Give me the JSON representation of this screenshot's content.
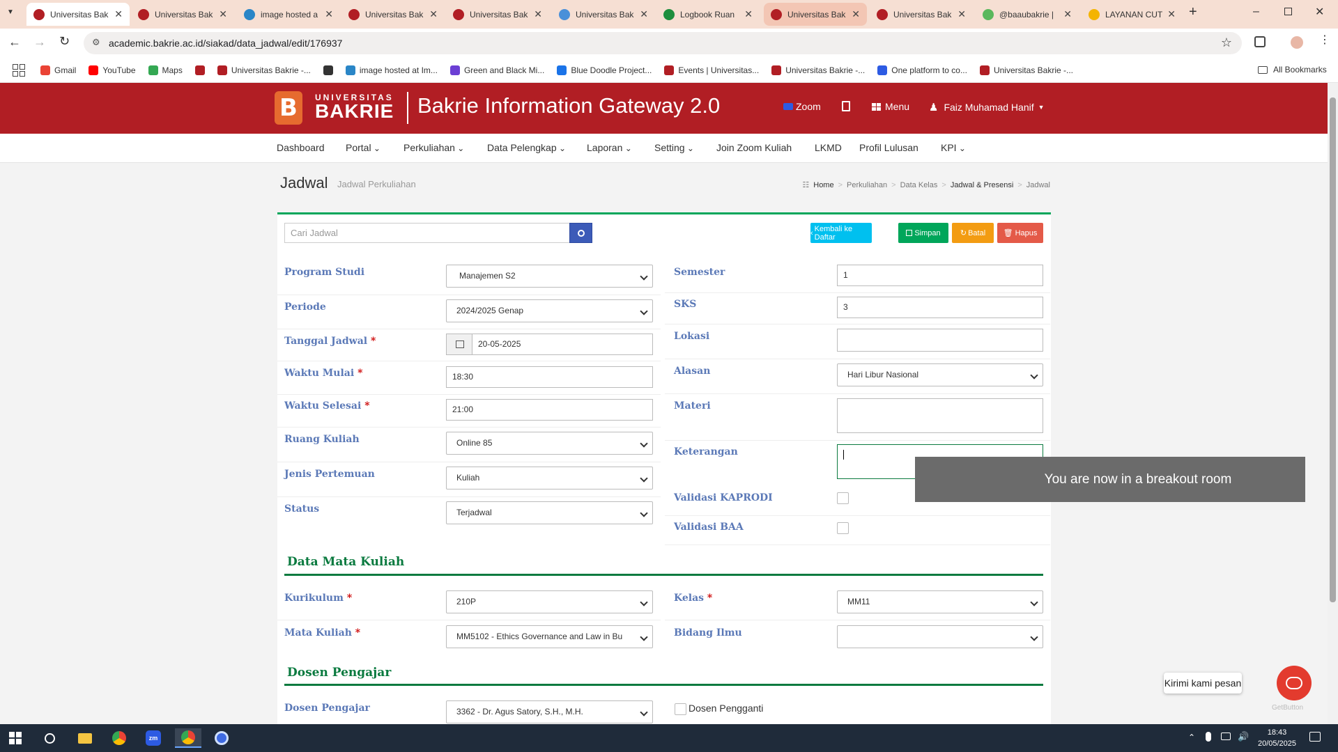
{
  "browser": {
    "tabs": [
      {
        "title": "Universitas Bak",
        "active": true,
        "color": "#b11e24"
      },
      {
        "title": "Universitas Bak",
        "color": "#b11e24"
      },
      {
        "title": "image hosted a",
        "color": "#2a86c7"
      },
      {
        "title": "Universitas Bak",
        "color": "#b11e24"
      },
      {
        "title": "Universitas Bak",
        "color": "#b11e24"
      },
      {
        "title": "Universitas Bak",
        "color": "#4a90d9"
      },
      {
        "title": "Logbook Ruan",
        "color": "#1e8e3e"
      },
      {
        "title": "Universitas Bak",
        "highlighted": true,
        "color": "#b11e24"
      },
      {
        "title": "Universitas Bak",
        "color": "#b11e24"
      },
      {
        "title": "@baaubakrie |",
        "color": "#5bb85d"
      },
      {
        "title": "LAYANAN CUT",
        "color": "#f4b400"
      }
    ],
    "url": "academic.bakrie.ac.id/siakad/data_jadwal/edit/176937",
    "bookmarks": [
      {
        "label": "Gmail",
        "color": "#ea4335"
      },
      {
        "label": "YouTube",
        "color": "#ff0000"
      },
      {
        "label": "Maps",
        "color": "#34a853"
      },
      {
        "label": "",
        "color": "#b11e24"
      },
      {
        "label": "Universitas Bakrie -...",
        "color": "#b11e24"
      },
      {
        "label": "",
        "color": "#333333"
      },
      {
        "label": "image hosted at Im...",
        "color": "#2a86c7"
      },
      {
        "label": "Green and Black Mi...",
        "color": "#6b3fd4"
      },
      {
        "label": "Blue Doodle Project...",
        "color": "#1a73e8"
      },
      {
        "label": "Events | Universitas...",
        "color": "#b11e24"
      },
      {
        "label": "Universitas Bakrie -...",
        "color": "#b11e24"
      },
      {
        "label": "One platform to co...",
        "color": "#2d5be3"
      },
      {
        "label": "Universitas Bakrie -...",
        "color": "#b11e24"
      }
    ],
    "all_bookmarks": "All Bookmarks"
  },
  "header": {
    "logo_line1": "UNIVERSITAS",
    "logo_line2": "BAKRIE",
    "title": "Bakrie Information Gateway 2.0",
    "zoom": "Zoom",
    "menu": "Menu",
    "user": "Faiz Muhamad Hanif",
    "brand_color": "#b11e24"
  },
  "nav": [
    "Dashboard",
    "Portal",
    "Perkuliahan",
    "Data Pelengkap",
    "Laporan",
    "Setting",
    "Join Zoom Kuliah",
    "LKMD",
    "Profil Lulusan",
    "KPI"
  ],
  "page": {
    "title": "Jadwal",
    "subtitle": "Jadwal Perkuliahan",
    "breadcrumb": [
      "Home",
      "Perkuliahan",
      "Data Kelas",
      "Jadwal & Presensi",
      "Jadwal"
    ]
  },
  "toolbar": {
    "search_placeholder": "Cari Jadwal",
    "back": "Kembali ke Daftar",
    "save": "Simpan",
    "cancel": "Batal",
    "delete": "Hapus"
  },
  "form_left": {
    "program_studi": {
      "label": "Program Studi",
      "value": "Manajemen S2"
    },
    "periode": {
      "label": "Periode",
      "value": "2024/2025 Genap"
    },
    "tanggal": {
      "label": "Tanggal Jadwal",
      "value": "20-05-2025"
    },
    "waktu_mulai": {
      "label": "Waktu Mulai",
      "value": "18:30"
    },
    "waktu_selesai": {
      "label": "Waktu Selesai",
      "value": "21:00"
    },
    "ruang": {
      "label": "Ruang Kuliah",
      "value": "Online 85"
    },
    "jenis": {
      "label": "Jenis Pertemuan",
      "value": "Kuliah"
    },
    "status": {
      "label": "Status",
      "value": "Terjadwal"
    }
  },
  "form_right": {
    "semester": {
      "label": "Semester",
      "value": "1"
    },
    "sks": {
      "label": "SKS",
      "value": "3"
    },
    "lokasi": {
      "label": "Lokasi",
      "value": ""
    },
    "alasan": {
      "label": "Alasan",
      "value": "Hari Libur Nasional"
    },
    "materi": {
      "label": "Materi",
      "value": ""
    },
    "keterangan": {
      "label": "Keterangan",
      "value": ""
    },
    "validasi_kaprodi": {
      "label": "Validasi KAPRODI"
    },
    "validasi_baa": {
      "label": "Validasi BAA"
    }
  },
  "mata_kuliah": {
    "section": "Data Mata Kuliah",
    "kurikulum": {
      "label": "Kurikulum",
      "value": "210P"
    },
    "kelas": {
      "label": "Kelas",
      "value": "MM11"
    },
    "mata_kuliah": {
      "label": "Mata Kuliah",
      "value": "MM5102 - Ethics Governance and Law in Bu"
    },
    "bidang_ilmu": {
      "label": "Bidang Ilmu",
      "value": ""
    }
  },
  "dosen": {
    "section": "Dosen Pengajar",
    "label": "Dosen Pengajar",
    "value": "3362 - Dr. Agus Satory, S.H., M.H.",
    "pengganti": "Dosen Pengganti"
  },
  "overlay": {
    "breakout": "You are now in a breakout room",
    "chat_tip": "Kirimi kami pesan",
    "getbutton": "GetButton"
  },
  "taskbar": {
    "time": "18:43",
    "date": "20/05/2025"
  }
}
